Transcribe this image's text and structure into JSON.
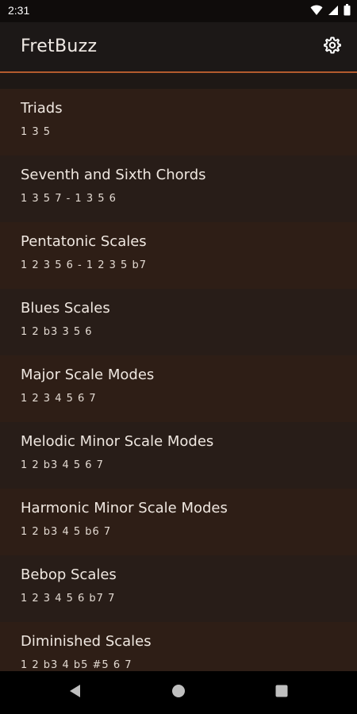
{
  "status_bar": {
    "time": "2:31",
    "icons": [
      "wifi-icon",
      "cell-signal-icon",
      "battery-icon"
    ]
  },
  "app_bar": {
    "title": "FretBuzz",
    "settings_icon": "gear-icon"
  },
  "colors": {
    "accent": "#b35b2e",
    "background": "#1e1815",
    "row_a": "#2e1e16",
    "row_b": "#281d18"
  },
  "items": [
    {
      "title": "Triads",
      "formula": "1 3 5"
    },
    {
      "title": "Seventh and Sixth Chords",
      "formula": "1 3 5 7 - 1 3 5 6"
    },
    {
      "title": "Pentatonic Scales",
      "formula": "1 2 3 5 6 - 1 2 3 5 b7"
    },
    {
      "title": "Blues Scales",
      "formula": "1 2 b3 3 5 6"
    },
    {
      "title": "Major Scale Modes",
      "formula": "1 2 3 4 5 6 7"
    },
    {
      "title": "Melodic Minor Scale Modes",
      "formula": "1 2 b3 4 5 6 7"
    },
    {
      "title": "Harmonic Minor Scale Modes",
      "formula": "1 2 b3 4 5 b6 7"
    },
    {
      "title": "Bebop Scales",
      "formula": "1 2 3 4 5 6 b7 7"
    },
    {
      "title": "Diminished Scales",
      "formula": "1 2 b3 4 b5 #5 6 7"
    }
  ],
  "nav_bar": {
    "icons": [
      "back-icon",
      "home-icon",
      "recents-icon"
    ]
  }
}
